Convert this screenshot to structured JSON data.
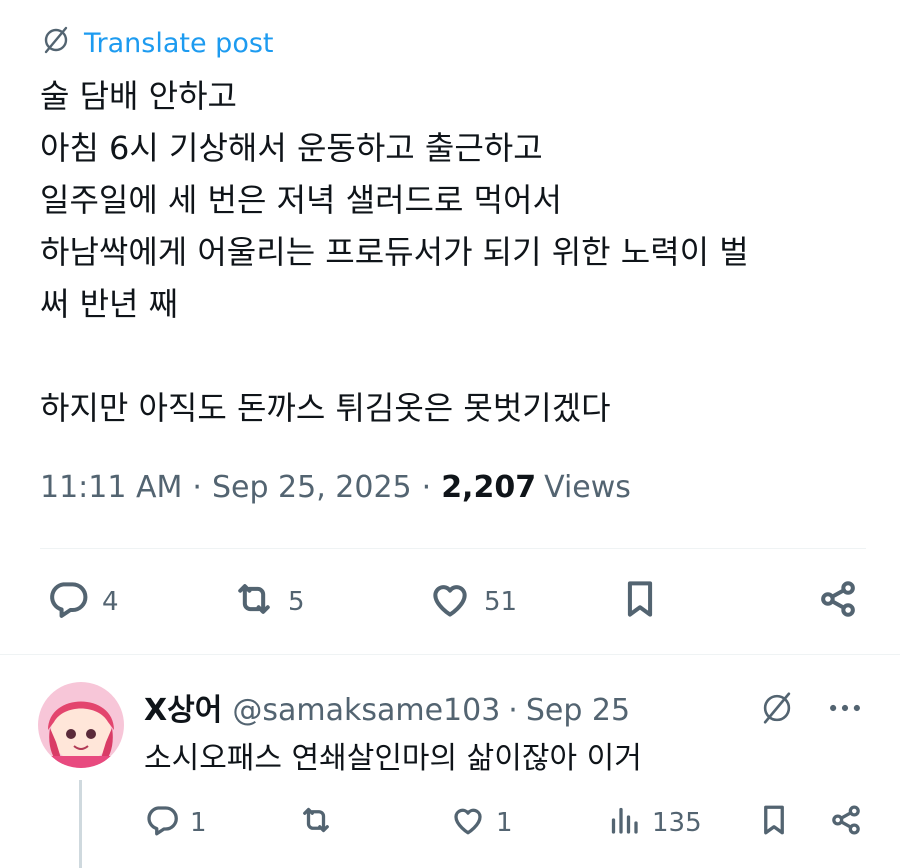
{
  "post": {
    "translate_label": "Translate post",
    "lines": [
      "술 담배 안하고",
      "아침 6시 기상해서 운동하고 출근하고",
      "일주일에 세 번은 저녁 샐러드로 먹어서",
      "하남싹에게 어울리는 프로듀서가 되기 위한 노력이 벌",
      "써 반년 째",
      "",
      "하지만 아직도 돈까스 튀김옷은 못벗기겠다"
    ],
    "time": "11:11 AM",
    "date": "Sep 25, 2025",
    "views_count": "2,207",
    "views_label": "Views",
    "separator": "·",
    "stats": {
      "replies": "4",
      "reposts": "5",
      "likes": "51"
    }
  },
  "reply": {
    "name": "X상어",
    "handle": "@samaksame103",
    "separator": "·",
    "date": "Sep 25",
    "text": "소시오패스 연쇄살인마의 삶이잖아 이거",
    "stats": {
      "replies": "1",
      "likes": "1",
      "views": "135"
    }
  },
  "colors": {
    "accent": "#1d9bf0",
    "text_primary": "#0f1419",
    "text_secondary": "#536471",
    "divider": "#eff3f4"
  }
}
